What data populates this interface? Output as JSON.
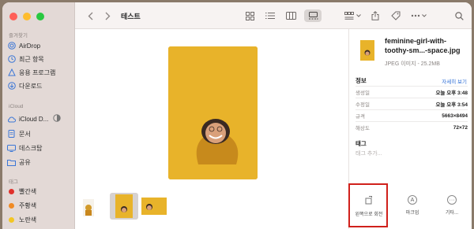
{
  "sidebar": {
    "sections": {
      "favorites": "즐겨찾기",
      "icloud": "iCloud",
      "tags": "태그"
    },
    "favorites": [
      {
        "label": "AirDrop",
        "icon": "airdrop-icon"
      },
      {
        "label": "최근 항목",
        "icon": "clock-icon"
      },
      {
        "label": "응용 프로그램",
        "icon": "apps-icon"
      },
      {
        "label": "다운로드",
        "icon": "download-icon"
      }
    ],
    "icloud": [
      {
        "label": "iCloud D...",
        "icon": "cloud-icon"
      },
      {
        "label": "문서",
        "icon": "doc-icon"
      },
      {
        "label": "데스크탑",
        "icon": "desktop-icon"
      },
      {
        "label": "공유",
        "icon": "shared-folder-icon"
      }
    ],
    "tags": [
      {
        "label": "빨간색",
        "color": "#e0312b"
      },
      {
        "label": "주황색",
        "color": "#f08a24"
      },
      {
        "label": "노란색",
        "color": "#f3c623"
      }
    ]
  },
  "toolbar": {
    "title": "테스트"
  },
  "inspector": {
    "filename": "feminine-girl-with-toothy-sm...-space.jpg",
    "kind": "JPEG 이미지 - 25.2MB",
    "info_title": "정보",
    "more_link": "자세히 보기",
    "info": [
      {
        "key": "생성일",
        "value": "오늘 오후 3:48"
      },
      {
        "key": "수정일",
        "value": "오늘 오후 3:54"
      },
      {
        "key": "규격",
        "value": "5663×8494"
      },
      {
        "key": "해상도",
        "value": "72×72"
      }
    ],
    "tags_title": "태그",
    "tags_placeholder": "태그 추가...",
    "actions": [
      {
        "label": "왼쪽으로 회전",
        "icon": "rotate-left-icon"
      },
      {
        "label": "마크업",
        "icon": "markup-icon"
      },
      {
        "label": "기타...",
        "icon": "more-icon"
      }
    ]
  },
  "colors": {
    "highlight": "#d0201b",
    "preview_bg": "#e8b32a"
  }
}
